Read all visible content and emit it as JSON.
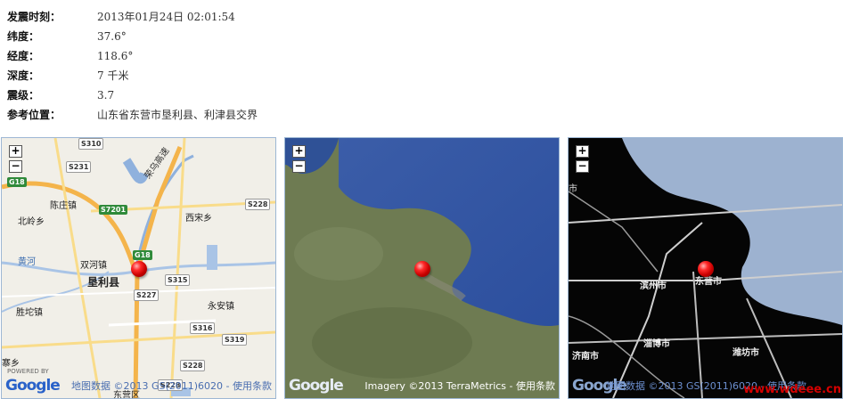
{
  "quake": {
    "time_label": "发震时刻：",
    "time": "2013年01月24日 02:01:54",
    "lat_label": "纬度：",
    "lat": "37.6°",
    "lon_label": "经度：",
    "lon": "118.6°",
    "depth_label": "深度：",
    "depth": "7 千米",
    "mag_label": "震级：",
    "mag": "3.7",
    "loc_label": "参考位置：",
    "loc": "山东省东营市垦利县、利津县交界"
  },
  "maps": {
    "zoom_in": "+",
    "zoom_out": "−",
    "map1": {
      "labels": [
        "陈庄镇",
        "西宋乡",
        "北岭乡",
        "黄河",
        "双河镇",
        "垦利县",
        "永安镇",
        "胜坨镇",
        "东营区",
        "寨乡"
      ],
      "shields": [
        "S310",
        "S231",
        "G18",
        "S7201",
        "S228",
        "G18",
        "S315",
        "S227",
        "S316",
        "S319",
        "S228",
        "S228"
      ],
      "road_name": "荣乌高速",
      "powered": "POWERED BY",
      "logo": "Google",
      "credit": "地图数据 ©2013 GS(2011)6020 - 使用条款"
    },
    "map2": {
      "logo": "Google",
      "credit": "Imagery ©2013 TerraMetrics - 使用条款"
    },
    "map3": {
      "labels": [
        "市",
        "滨州市",
        "东营市",
        "济南市",
        "淄博市",
        "潍坊市"
      ],
      "logo": "Google",
      "credit": "地图数据 ©2013 GS(2011)6020 - 使用条款"
    }
  },
  "watermark": "www.wdeee.cn"
}
